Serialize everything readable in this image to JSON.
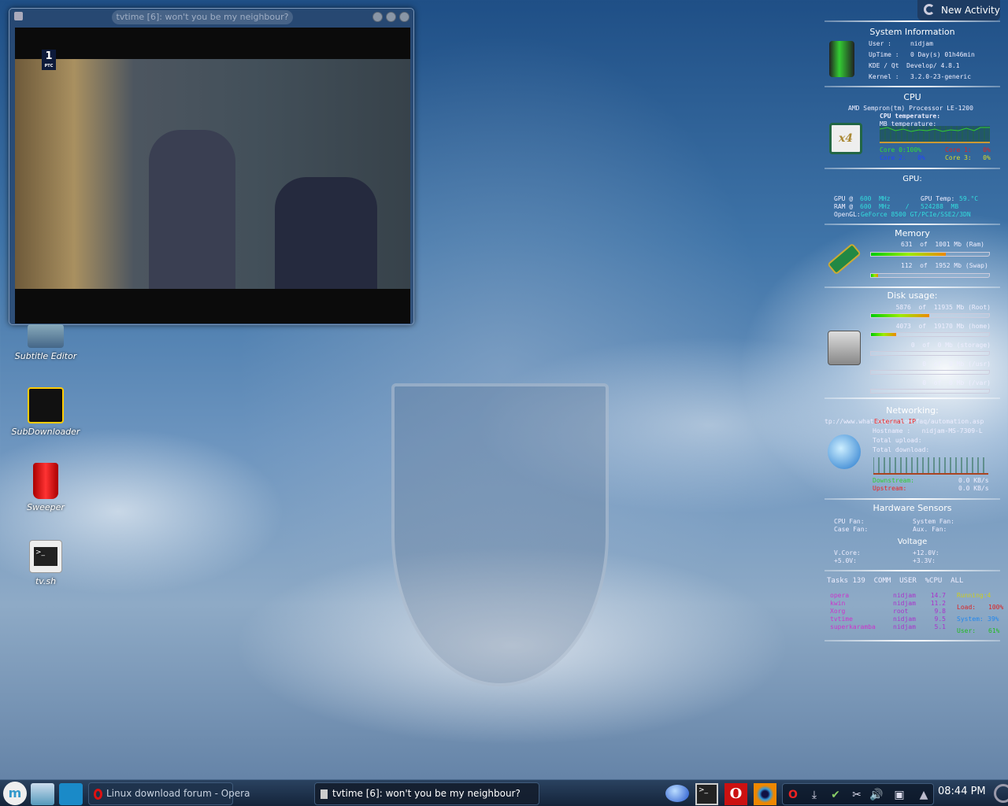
{
  "window": {
    "title": "tvtime [6]: won't you be my neighbour?",
    "channel_logo": "1 РТС"
  },
  "desktop_icons": [
    {
      "label": "Subtitle Editor",
      "icon": "subtitle-editor-icon"
    },
    {
      "label": "SubDownloader",
      "icon": "subdownloader-icon"
    },
    {
      "label": "Sweeper",
      "icon": "sweeper-trash-icon"
    },
    {
      "label": "tv.sh",
      "icon": "terminal-script-icon"
    }
  ],
  "new_activity": "New Activity",
  "sysinfo": {
    "title": "System Information",
    "user": "User :     nidjam",
    "uptime": "UpTime :   0 Day(s) 01h46min",
    "kde": "KDE / Qt  Develop/ 4.8.1",
    "kernel": "Kernel :   3.2.0-23-generic"
  },
  "cpu": {
    "title": "CPU",
    "model": "AMD Sempron(tm) Processor LE-1200",
    "cpu_temp": "CPU temperature:",
    "mb_temp": "MB temperature:",
    "core0": "Core 0:100%",
    "core1": "Core 1:   0%",
    "core2": "Core 2:   0%",
    "core3": "Core 3:   0%",
    "colors": {
      "core0": "#33dd33",
      "core1": "#dd2222",
      "core2": "#2244ff",
      "core3": "#dddd22"
    }
  },
  "gpu": {
    "title": "GPU:",
    "gpu_label": "GPU @",
    "gpu_val": "600  MHz",
    "ram_label": "RAM @",
    "ram_val": "600  MHz    /",
    "temp_label": "GPU Temp:",
    "temp_val": "59.°C",
    "mem_val": "524288  MB",
    "opengl_label": "OpenGL:",
    "opengl_val": "GeForce 8500 GT/PCIe/SSE2/3DN"
  },
  "memory": {
    "title": "Memory",
    "ram": {
      "text": "631  of  1001 Mb (Ram)",
      "percent": 63
    },
    "swap": {
      "text": "112  of  1952 Mb (Swap)",
      "percent": 6
    }
  },
  "disk": {
    "title": "Disk usage:",
    "items": [
      {
        "text": "5876  of  11935 Mb (Root)",
        "percent": 49
      },
      {
        "text": "4073  of  19170 Mb (home)",
        "percent": 21
      },
      {
        "text": "0  of  0 Mb (storage)",
        "percent": 0
      },
      {
        "text": "0  of  0 Mb (/usr)",
        "percent": 0
      },
      {
        "text": "0  of  0 Mb (/var)",
        "percent": 0
      }
    ]
  },
  "network": {
    "title": "Networking:",
    "url": "tp://www.whatismyip.com/faq/automation.asp",
    "external_ip": "External IP",
    "hostname": "Hostname :   nidjam-MS-7309-L",
    "upload": "Total upload:",
    "download": "Total download:",
    "downstream_label": "Downstream:",
    "downstream_val": "0.0 KB/s",
    "upstream_label": "Upstream:",
    "upstream_val": "0.0 KB/s"
  },
  "sensors": {
    "title": "Hardware Sensors",
    "cpu_fan": "CPU Fan:",
    "case_fan": "Case Fan:",
    "system_fan": "System Fan:",
    "aux_fan": "Aux. Fan:",
    "voltage_title": "Voltage",
    "vcore": "V.Core:",
    "v5": "+5.0V:",
    "v12": "+12.0V:",
    "v33": "+3.3V:"
  },
  "tasks": {
    "header": "Tasks 139  COMM  USER  %CPU  ALL",
    "rows": [
      {
        "comm": "opera",
        "user": "nidjam",
        "cpu": "14.7"
      },
      {
        "comm": "kwin",
        "user": "nidjam",
        "cpu": "11.2"
      },
      {
        "comm": "Xorg",
        "user": "root",
        "cpu": "9.8"
      },
      {
        "comm": "tvtime",
        "user": "nidjam",
        "cpu": "9.5"
      },
      {
        "comm": "superkaramba",
        "user": "nidjam",
        "cpu": "5.1"
      }
    ],
    "running": "Running:4",
    "load_label": "Load:",
    "load_val": "100%",
    "system_label": "System:",
    "system_val": "39%",
    "user_label": "User:",
    "user_val": "61%"
  },
  "taskbar": {
    "tasks": [
      {
        "label": "Linux download forum - Opera",
        "icon": "opera-icon"
      },
      {
        "label": "tvtime [6]: won't you be my neighbour?",
        "icon": "tvtime-icon"
      }
    ],
    "clock": "08:44 PM"
  }
}
